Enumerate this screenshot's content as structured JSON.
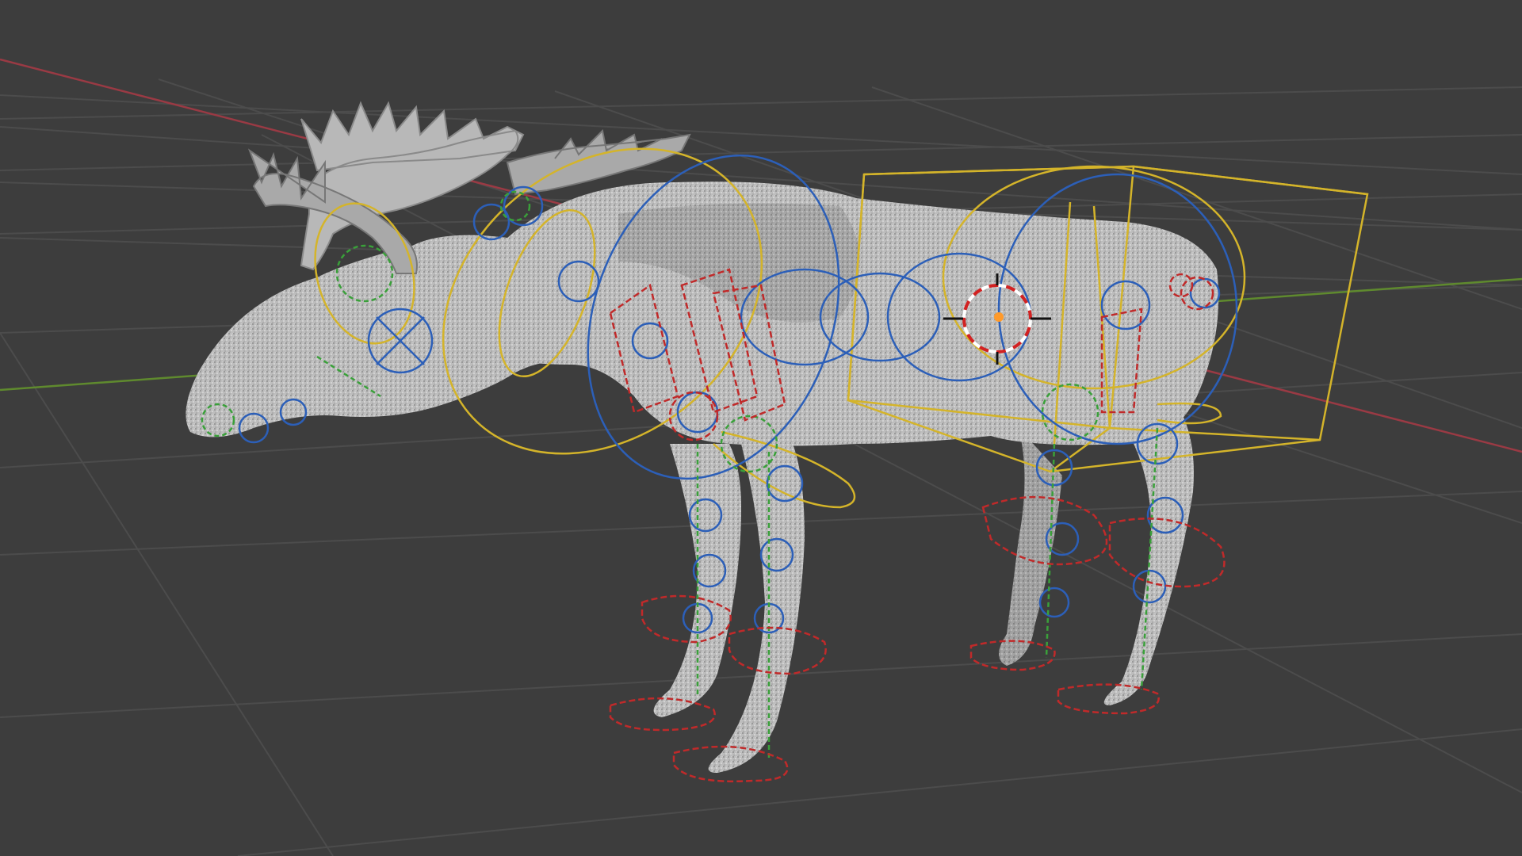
{
  "viewport": {
    "editor": "3d-viewport",
    "background_color": "#3d3d3d",
    "grid_color": "#4a4a4a",
    "x_axis_color": "#9a3a44",
    "y_axis_color": "#5f8a2e",
    "show_grid": true
  },
  "scene": {
    "model": "moose",
    "mesh_color": "#c9c9c9",
    "antler_color": "#b5b5b5",
    "rig_colors": {
      "ik_controls": "#d4b42a",
      "fk_controls": "#2c5fb8",
      "tweak_controls": "#3aa03a",
      "foot_controls": "#c02a2a"
    },
    "3d_cursor_icon": "3d-cursor-icon",
    "origin_color": "#ff9a2a"
  }
}
